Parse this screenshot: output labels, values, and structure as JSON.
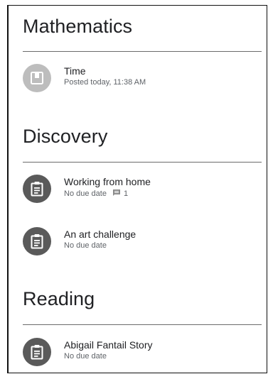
{
  "sections": [
    {
      "title": "Mathematics",
      "items": [
        {
          "title": "Time",
          "meta": "Posted today, 11:38 AM",
          "icon": "material-icon"
        }
      ]
    },
    {
      "title": "Discovery",
      "items": [
        {
          "title": "Working from home",
          "meta": "No due date",
          "comment_count": "1",
          "icon": "assignment-icon"
        },
        {
          "title": "An art challenge",
          "meta": "No due date",
          "icon": "assignment-icon"
        }
      ]
    },
    {
      "title": "Reading",
      "items": [
        {
          "title": "Abigail Fantail Story",
          "meta": "No due date",
          "icon": "assignment-icon"
        }
      ]
    }
  ],
  "colors": {
    "avatar_light": "#bdbdbd",
    "avatar_dark": "#5a5a5a",
    "divider": "#6b6b6b",
    "meta_text": "#5f6368"
  }
}
